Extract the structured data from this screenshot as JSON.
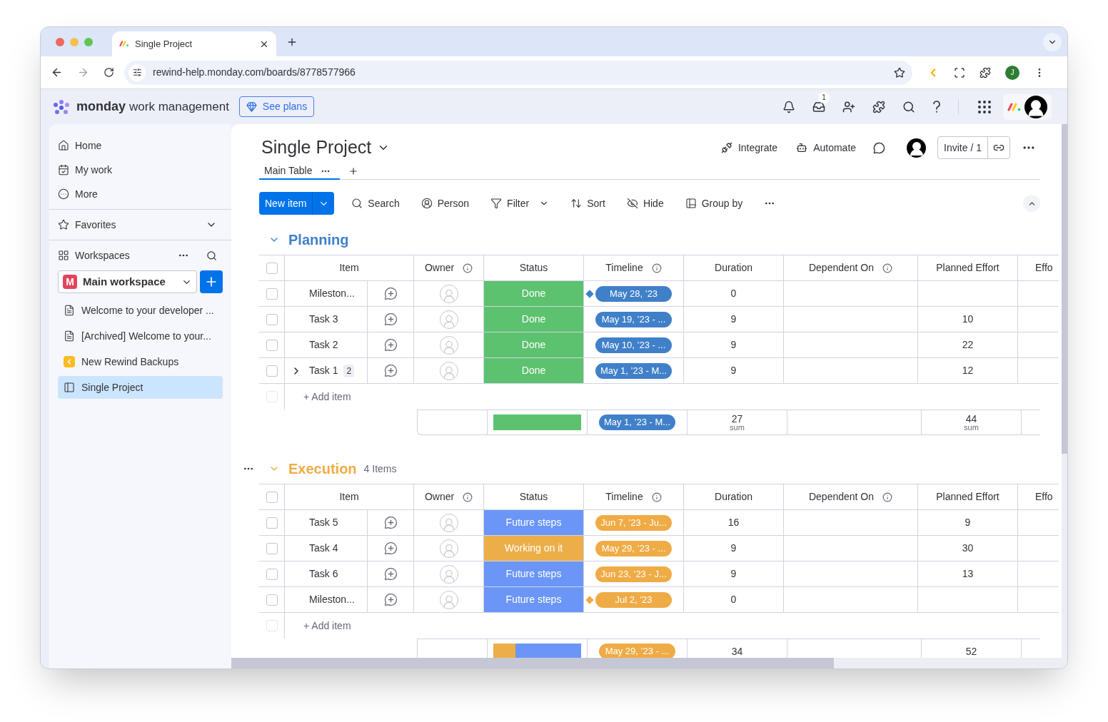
{
  "browser": {
    "tab_title": "Single Project",
    "url": "rewind-help.monday.com/boards/8778577966",
    "profile_initial": "J"
  },
  "app_header": {
    "brand": "monday",
    "product": "work management",
    "plans_button": "See plans",
    "inbox_badge": "1"
  },
  "sidebar": {
    "nav": [
      {
        "label": "Home",
        "kind": "home"
      },
      {
        "label": "My work",
        "kind": "calendar"
      },
      {
        "label": "More",
        "kind": "more"
      }
    ],
    "favorites": "Favorites",
    "workspaces": "Workspaces",
    "workspace": {
      "name": "Main workspace",
      "initial": "M"
    },
    "boards": [
      {
        "label": "Welcome to your developer ...",
        "kind": "doc",
        "selected": false
      },
      {
        "label": "[Archived] Welcome to your...",
        "kind": "doc",
        "selected": false
      },
      {
        "label": "New Rewind Backups",
        "kind": "app",
        "selected": false
      },
      {
        "label": "Single Project",
        "kind": "board",
        "selected": true
      }
    ]
  },
  "board": {
    "title": "Single Project",
    "views": [
      {
        "label": "Main Table",
        "selected": true
      }
    ],
    "integrate": "Integrate",
    "automate": "Automate",
    "invite": "Invite / 1"
  },
  "toolbar": {
    "new_item": "New item",
    "tools": [
      {
        "label": "Search",
        "kind": "search"
      },
      {
        "label": "Person",
        "kind": "person"
      },
      {
        "label": "Filter",
        "kind": "filter"
      },
      {
        "label": "Sort",
        "kind": "sort"
      },
      {
        "label": "Hide",
        "kind": "hide"
      },
      {
        "label": "Group by",
        "kind": "group"
      }
    ]
  },
  "groups": [
    {
      "title": "Planning",
      "color": "#4080c9",
      "hovered": false,
      "all_checked": false,
      "add_checkbox_disabled": true,
      "columns": [
        {
          "label": "Item",
          "info": false
        },
        {
          "label": "Owner",
          "info": true
        },
        {
          "label": "Status",
          "info": false
        },
        {
          "label": "Timeline",
          "info": true
        },
        {
          "label": "Duration",
          "info": false
        },
        {
          "label": "Dependent On",
          "info": true
        },
        {
          "label": "Planned Effort",
          "info": false
        },
        {
          "label": "Effo"
        }
      ],
      "rows": [
        {
          "name": "Mileston...",
          "checked": false,
          "expandable": false,
          "status": {
            "label": "Done",
            "color": "#5cc26f"
          },
          "timeline": {
            "label": "May 28, ’23",
            "milestone": true
          },
          "duration": "0"
        },
        {
          "name": "Task 3",
          "checked": false,
          "expandable": false,
          "status": {
            "label": "Done",
            "color": "#5cc26f"
          },
          "timeline": {
            "label": "May 19, ’23 - ...",
            "milestone": false
          },
          "duration": "9",
          "effort": "10"
        },
        {
          "name": "Task 2",
          "checked": false,
          "expandable": false,
          "status": {
            "label": "Done",
            "color": "#5cc26f"
          },
          "timeline": {
            "label": "May 10, ’23 - ...",
            "milestone": false
          },
          "duration": "9",
          "effort": "22"
        },
        {
          "name": "Task 1",
          "checked": false,
          "expandable": true,
          "subitems": "2",
          "status": {
            "label": "Done",
            "color": "#5cc26f"
          },
          "timeline": {
            "label": "May 1, ’23 - M...",
            "milestone": false
          },
          "duration": "9",
          "effort": "12"
        }
      ],
      "add_item": "+ Add item",
      "summary": {
        "bar": {
          "color": "#5cc26f"
        },
        "timeline": "May 1, ’23 - M...",
        "duration": "27",
        "duration_label": "sum",
        "effort": "44",
        "effort_label": "sum"
      }
    },
    {
      "title": "Execution",
      "count": "4 Items",
      "color": "#efab45",
      "hovered": true,
      "all_checked": false,
      "add_checkbox_disabled": true,
      "columns": [
        {
          "label": "Item",
          "info": false
        },
        {
          "label": "Owner",
          "info": true
        },
        {
          "label": "Status",
          "info": false
        },
        {
          "label": "Timeline",
          "info": true
        },
        {
          "label": "Duration",
          "info": false
        },
        {
          "label": "Dependent On",
          "info": true
        },
        {
          "label": "Planned Effort",
          "info": false
        },
        {
          "label": "Effo"
        }
      ],
      "rows": [
        {
          "name": "Task 5",
          "checked": false,
          "expandable": false,
          "status": {
            "label": "Future steps",
            "color": "#6b96f8"
          },
          "timeline": {
            "label": "Jun 7, ’23 - Ju...",
            "milestone": false
          },
          "duration": "16",
          "effort": "9"
        },
        {
          "name": "Task 4",
          "checked": false,
          "expandable": false,
          "status": {
            "label": "Working on it",
            "color": "#ecae49"
          },
          "timeline": {
            "label": "May 29, ’23 - ...",
            "milestone": false
          },
          "duration": "9",
          "effort": "30"
        },
        {
          "name": "Task 6",
          "checked": false,
          "expandable": false,
          "status": {
            "label": "Future steps",
            "color": "#6b96f8"
          },
          "timeline": {
            "label": "Jun 23, ’23 - J...",
            "milestone": false
          },
          "duration": "9",
          "effort": "13"
        },
        {
          "name": "Mileston...",
          "checked": false,
          "expandable": false,
          "status": {
            "label": "Future steps",
            "color": "#6b96f8"
          },
          "timeline": {
            "label": "Jul 2, ’23",
            "milestone": true
          },
          "duration": "0"
        }
      ],
      "add_item": "+ Add item",
      "summary": {
        "bar": {
          "color": "#6b96f8",
          "fill": {
            "color": "#ecae49",
            "level": 0.25
          }
        },
        "timeline": "May 29, ’23 - ...",
        "duration": "34",
        "effort": "52"
      }
    }
  ]
}
